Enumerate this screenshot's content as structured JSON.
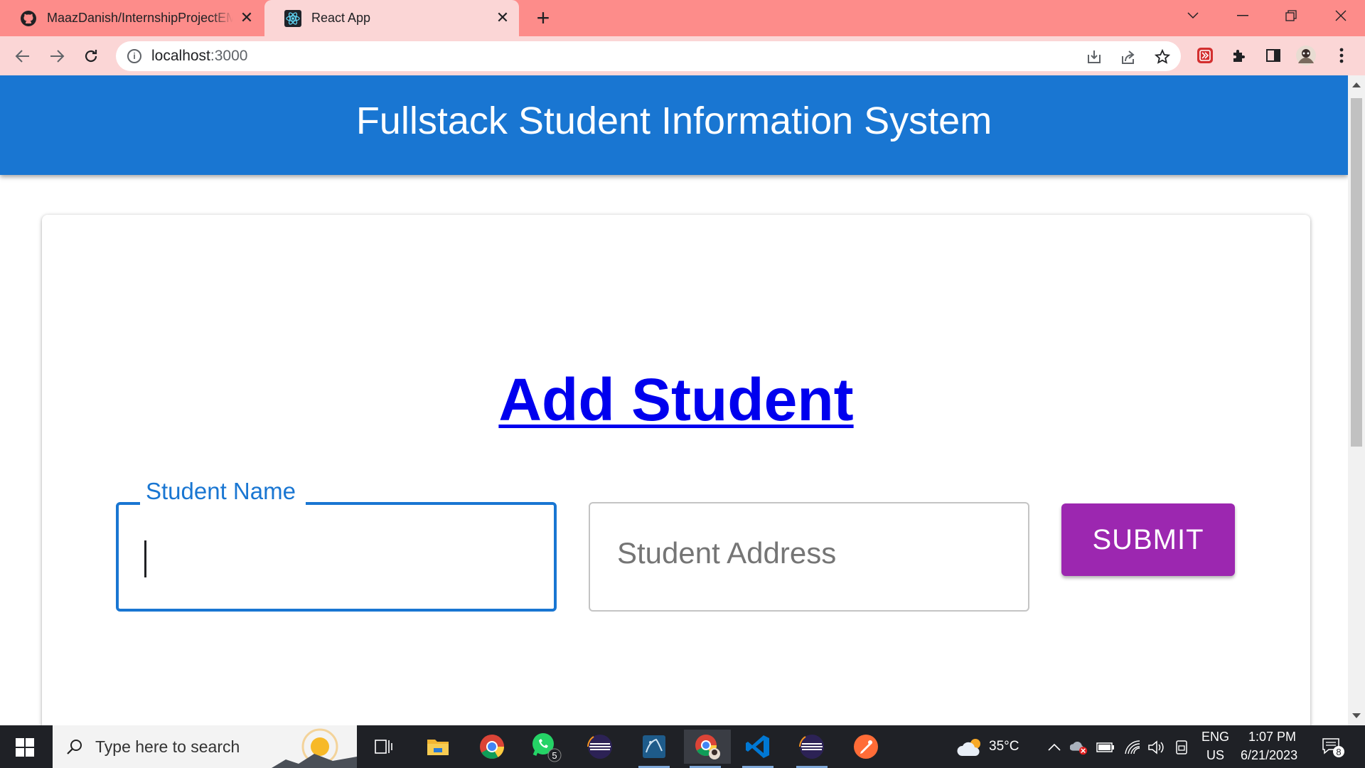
{
  "browser": {
    "tabs": [
      {
        "title": "MaazDanish/InternshipProjectEM",
        "active": false
      },
      {
        "title": "React App",
        "active": true
      }
    ],
    "url_host": "localhost",
    "url_port": ":3000"
  },
  "app": {
    "title": "Fullstack Student Information System",
    "heading": "Add Student",
    "name_field": {
      "label": "Student Name",
      "value": ""
    },
    "address_field": {
      "placeholder": "Student Address",
      "value": ""
    },
    "submit_label": "SUBMIT"
  },
  "taskbar": {
    "search_placeholder": "Type here to search",
    "whatsapp_badge": "5",
    "weather": "35°C",
    "language_top": "ENG",
    "language_bottom": "US",
    "time": "1:07 PM",
    "date": "6/21/2023",
    "notification_count": "8"
  },
  "colors": {
    "tabstrip": "#fd8c8a",
    "toolbar": "#fbd6d6",
    "appbar": "#1976d2",
    "submit": "#9c27b0",
    "heading_link": "#0000ee"
  }
}
